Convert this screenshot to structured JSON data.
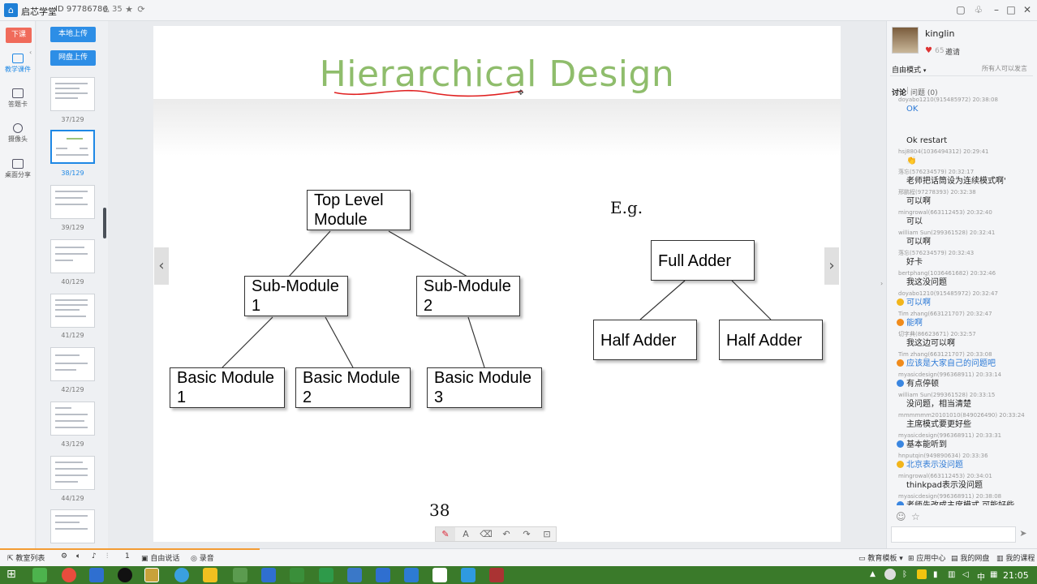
{
  "titlebar": {
    "app_name": "启芯学堂",
    "room_id": "ID 97786786",
    "user_count": "35"
  },
  "left_rail": {
    "end_class": "下课",
    "items": [
      {
        "label": "教学课件",
        "icon": "courseware-icon"
      },
      {
        "label": "答题卡",
        "icon": "answer-card-icon"
      },
      {
        "label": "摄像头",
        "icon": "camera-icon"
      },
      {
        "label": "桌面分享",
        "icon": "desktop-share-icon"
      }
    ]
  },
  "thumbnails": {
    "local_upload": "本地上传",
    "cloud_upload": "网盘上传",
    "pages": [
      "37/129",
      "38/129",
      "39/129",
      "40/129",
      "41/129",
      "42/129",
      "43/129",
      "44/129"
    ],
    "active_page": "38/129"
  },
  "slide": {
    "title": "Hierarchical Design",
    "top_module": [
      "Top Level",
      "Module"
    ],
    "sub_module_1": [
      "Sub-Module",
      "1"
    ],
    "sub_module_2": [
      "Sub-Module",
      "2"
    ],
    "basic_1": [
      "Basic Module",
      "1"
    ],
    "basic_2": [
      "Basic Module",
      "2"
    ],
    "basic_3": [
      "Basic Module",
      "3"
    ],
    "eg": "E.g.",
    "full_adder": "Full Adder",
    "half_adder_1": "Half Adder",
    "half_adder_2": "Half Adder",
    "page_number": "38"
  },
  "chat": {
    "teacher_name": "kinglin",
    "likes": "65",
    "invite": "邀请",
    "mode": "自由模式",
    "can_speak": "所有人可以发言",
    "tab_discuss": "讨论",
    "tab_question": "问题 (0)",
    "messages": [
      {
        "meta": "doyabo1210(915485972) 20:38:08",
        "text": "OK",
        "blue": true,
        "badge": ""
      },
      {
        "meta": "",
        "text": "Ok restart",
        "blue": false,
        "badge": ""
      },
      {
        "meta": "hsj8804(1036494312) 20:29:41",
        "text": "👏",
        "blue": false,
        "badge": ""
      },
      {
        "meta": "落忘(576234579) 20:32:17",
        "text": "老师把话筒设为连续模式啊'",
        "blue": false,
        "badge": ""
      },
      {
        "meta": "邢鹏程(97278393) 20:32:38",
        "text": "可以啊",
        "blue": false,
        "badge": ""
      },
      {
        "meta": "mingrowal(663112453) 20:32:40",
        "text": "可以",
        "blue": false,
        "badge": ""
      },
      {
        "meta": "william Sun(299361528) 20:32:41",
        "text": "可以啊",
        "blue": false,
        "badge": ""
      },
      {
        "meta": "落忘(576234579) 20:32:43",
        "text": "好卡",
        "blue": false,
        "badge": ""
      },
      {
        "meta": "bertphang(1036461682) 20:32:46",
        "text": "我这没问题",
        "blue": false,
        "badge": ""
      },
      {
        "meta": "doyabo1210(915485972) 20:32:47",
        "text": "可以啊",
        "blue": true,
        "badge": "gold"
      },
      {
        "meta": "Tim zhang(663121707) 20:32:47",
        "text": "能啊",
        "blue": true,
        "badge": "orange"
      },
      {
        "meta": "切字典(86623671) 20:32:57",
        "text": "我这边可以啊",
        "blue": false,
        "badge": ""
      },
      {
        "meta": "Tim zhang(663121707) 20:33:08",
        "text": "应该是大家自己的问题吧",
        "blue": true,
        "badge": "orange"
      },
      {
        "meta": "myasicdesign(996368911) 20:33:14",
        "text": "有点停顿",
        "blue": false,
        "badge": "blue"
      },
      {
        "meta": "william Sun(299361528) 20:33:15",
        "text": "没问题，相当清楚",
        "blue": false,
        "badge": ""
      },
      {
        "meta": "mmmmmm20101010(849026490) 20:33:24",
        "text": "主席模式要更好些",
        "blue": false,
        "badge": ""
      },
      {
        "meta": "myasicdesign(996368911) 20:33:31",
        "text": "基本能听到",
        "blue": false,
        "badge": "blue"
      },
      {
        "meta": "hnputqin(949890634) 20:33:36",
        "text": "北京表示没问题",
        "blue": true,
        "badge": "gold"
      },
      {
        "meta": "mingrowal(663112453) 20:34:01",
        "text": "thinkpad表示没问题",
        "blue": false,
        "badge": ""
      },
      {
        "meta": "myasicdesign(996368911) 20:38:08",
        "text": "老师先改成主席模式 可能好些",
        "blue": false,
        "badge": "blue"
      }
    ]
  },
  "bottombar": {
    "class_list": "教室列表",
    "free_talk": "自由说话",
    "record": "录音",
    "edu_template": "教育模板",
    "app_center": "应用中心",
    "my_disk": "我的网盘",
    "my_course": "我的课程"
  },
  "taskbar": {
    "time": "21:05"
  },
  "colors": {
    "accent_blue": "#1e88e5",
    "end_class_red": "#f06b5b",
    "title_green": "#8fbd6c",
    "taskbar_green": "#3a7a2a"
  }
}
